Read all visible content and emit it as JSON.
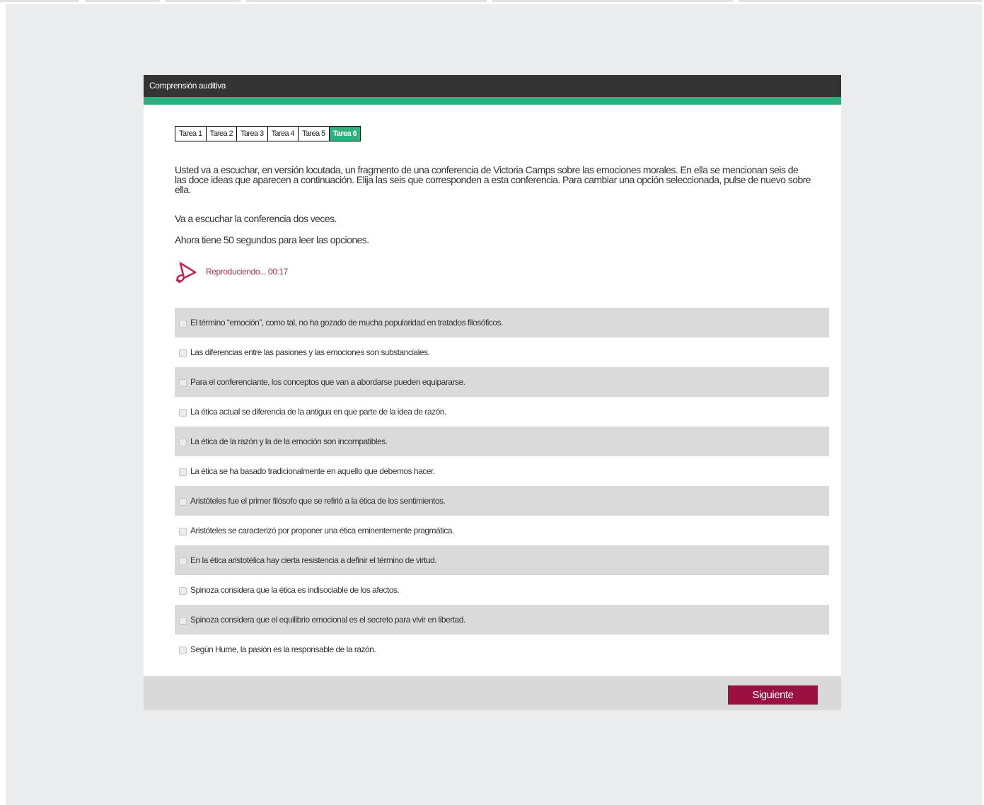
{
  "header": {
    "title": "Comprensión auditiva"
  },
  "tabs": [
    {
      "label": "Tarea 1",
      "active": false
    },
    {
      "label": "Tarea 2",
      "active": false
    },
    {
      "label": "Tarea 3",
      "active": false
    },
    {
      "label": "Tarea 4",
      "active": false
    },
    {
      "label": "Tarea 5",
      "active": false
    },
    {
      "label": "Tarea 6",
      "active": true
    }
  ],
  "instructions": {
    "intro": "Usted va a escuchar, en versión locutada, un fragmento de una conferencia de Victoria Camps sobre las emociones morales. En ella se mencionan seis de las doce ideas que aparecen a continuación. Elija las seis que corresponden a esta conferencia. Para cambiar una opción seleccionada, pulse de nuevo sobre ella.",
    "times": "Va a escuchar la conferencia dos veces.",
    "reading": "Ahora tiene 50 segundos para leer las opciones."
  },
  "player": {
    "status": "Reproduciendo... 00:17",
    "icon": "megaphone-icon",
    "color": "#c0284f"
  },
  "options": [
    "El término “emoción”, como tal, no ha gozado de mucha popularidad en tratados filosóficos.",
    "Las diferencias entre las pasiones y las emociones son substanciales.",
    "Para el conferenciante, los conceptos que van a abordarse pueden equipararse.",
    "La ética actual se diferencia de la antigua en que parte de la idea de razón.",
    "La ética de la razón y la de la emoción son incompatibles.",
    "La ética se ha basado tradicionalmente en aquello que debemos hacer.",
    "Aristóteles fue el primer filósofo que se refirió a la ética de los sentimientos.",
    "Aristóteles se caracterizó por proponer una ética eminentemente pragmática.",
    "En la ética aristotélica hay cierta resistencia a definir el término de virtud.",
    "Spinoza considera que la ética es indisociable de los afectos.",
    "Spinoza considera que el equilibrio emocional es el secreto para vivir en libertad.",
    "Según Hume, la pasión es la responsable de la razón."
  ],
  "footer": {
    "next_label": "Siguiente"
  },
  "colors": {
    "header_bg": "#333333",
    "accent_green": "#2eaf7d",
    "button_bg": "#9b0f41",
    "page_bg": "#ebecee"
  }
}
